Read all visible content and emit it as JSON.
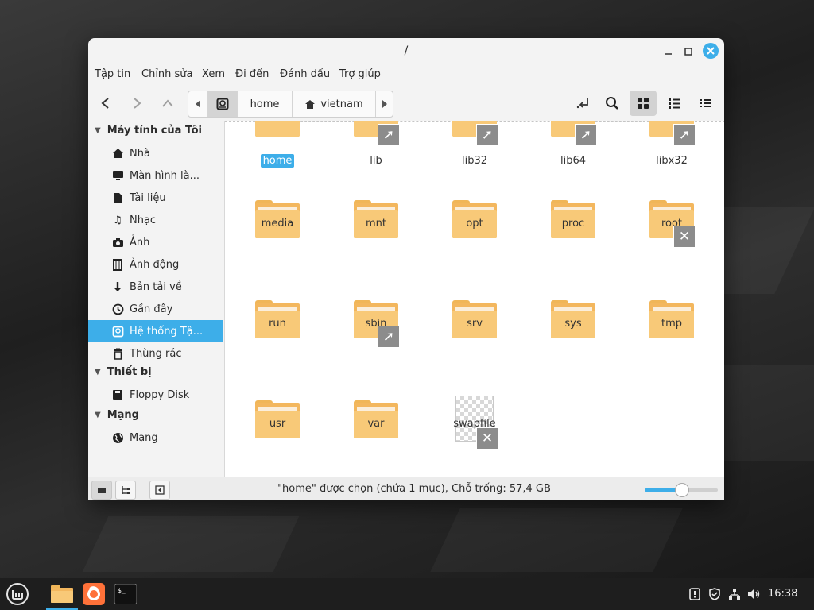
{
  "window": {
    "title": "/"
  },
  "menu": [
    "Tập tin",
    "Chỉnh sửa",
    "Xem",
    "Đi đến",
    "Đánh dấu",
    "Trợ giúp"
  ],
  "pathbar": {
    "home_label": "home",
    "user_label": "vietnam"
  },
  "sidebar": {
    "sections": [
      {
        "title": "Máy tính của Tôi",
        "items": [
          {
            "label": "Nhà",
            "icon": "home-icon"
          },
          {
            "label": "Màn hình là...",
            "icon": "desktop-icon"
          },
          {
            "label": "Tài liệu",
            "icon": "document-icon"
          },
          {
            "label": "Nhạc",
            "icon": "music-icon"
          },
          {
            "label": "Ảnh",
            "icon": "camera-icon"
          },
          {
            "label": "Ảnh động",
            "icon": "film-icon"
          },
          {
            "label": "Bản tải về",
            "icon": "download-icon"
          },
          {
            "label": "Gần đây",
            "icon": "clock-icon"
          },
          {
            "label": "Hệ thống Tậ...",
            "icon": "drive-icon",
            "selected": true
          },
          {
            "label": "Thùng rác",
            "icon": "trash-icon"
          }
        ]
      },
      {
        "title": "Thiết bị",
        "items": [
          {
            "label": "Floppy Disk",
            "icon": "floppy-icon"
          }
        ]
      },
      {
        "title": "Mạng",
        "items": [
          {
            "label": "Mạng",
            "icon": "network-icon"
          }
        ]
      }
    ]
  },
  "files": [
    {
      "name": "home",
      "type": "folder",
      "selected": true
    },
    {
      "name": "lib",
      "type": "folder",
      "emblem": "link"
    },
    {
      "name": "lib32",
      "type": "folder",
      "emblem": "link"
    },
    {
      "name": "lib64",
      "type": "folder",
      "emblem": "link"
    },
    {
      "name": "libx32",
      "type": "folder",
      "emblem": "link"
    },
    {
      "name": "media",
      "type": "folder"
    },
    {
      "name": "mnt",
      "type": "folder"
    },
    {
      "name": "opt",
      "type": "folder"
    },
    {
      "name": "proc",
      "type": "folder"
    },
    {
      "name": "root",
      "type": "folder",
      "emblem": "locked"
    },
    {
      "name": "run",
      "type": "folder"
    },
    {
      "name": "sbin",
      "type": "folder",
      "emblem": "link"
    },
    {
      "name": "srv",
      "type": "folder"
    },
    {
      "name": "sys",
      "type": "folder"
    },
    {
      "name": "tmp",
      "type": "folder"
    },
    {
      "name": "usr",
      "type": "folder"
    },
    {
      "name": "var",
      "type": "folder"
    },
    {
      "name": "swapfile",
      "type": "file",
      "emblem": "locked"
    }
  ],
  "status": {
    "text": "\"home\" được chọn (chứa 1 mục), Chỗ trống: 57,4 GB",
    "zoom_level": 0.5
  },
  "taskbar": {
    "apps": [
      "mint-menu-icon",
      "files-icon",
      "firefox-icon",
      "terminal-icon"
    ],
    "clock": "16:38"
  },
  "colors": {
    "accent": "#3daee9",
    "folder": "#f8c978",
    "taskbar": "#1e1e1e"
  }
}
